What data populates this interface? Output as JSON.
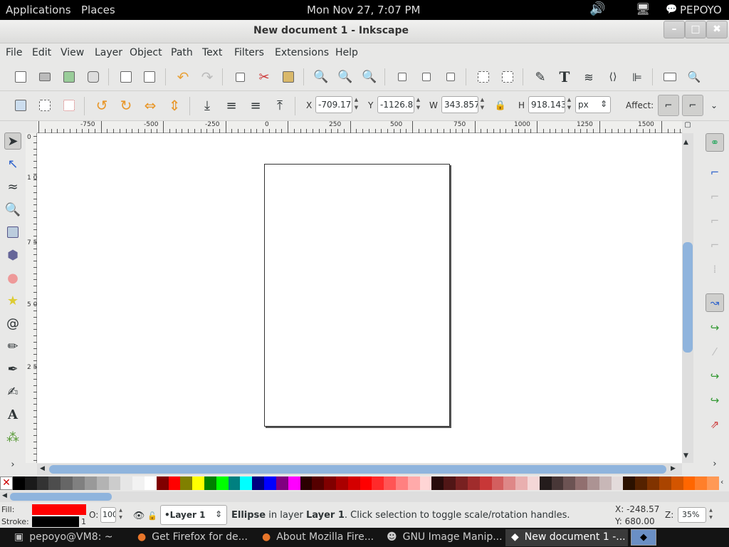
{
  "topbar": {
    "applications": "Applications",
    "places": "Places",
    "clock": "Mon Nov 27,  7:07 PM",
    "user": "PEPOYO"
  },
  "window": {
    "title": "New document 1 - Inkscape",
    "minimize": "–",
    "maximize": "□",
    "close": "✖"
  },
  "menu": [
    "File",
    "Edit",
    "View",
    "Layer",
    "Object",
    "Path",
    "Text",
    "Filters",
    "Extensions",
    "Help"
  ],
  "toolbar": {
    "x_label": "X",
    "x_value": "-709.17",
    "y_label": "Y",
    "y_value": "-1126.8",
    "w_label": "W",
    "w_value": "343.857",
    "h_label": "H",
    "h_value": "918.143",
    "unit": "px",
    "affect_label": "Affect:"
  },
  "ruler": {
    "h_ticks": [
      "-750",
      "-500",
      "-250",
      "0",
      "250",
      "500",
      "750",
      "1000",
      "1250",
      "1500"
    ],
    "v_ticks": [
      "0",
      "1 0 0 0",
      "7 5 0",
      "5 0 0",
      "2 5 0"
    ]
  },
  "palette": {
    "colors": [
      "#000000",
      "#1a1a1a",
      "#333333",
      "#4d4d4d",
      "#666666",
      "#808080",
      "#999999",
      "#b3b3b3",
      "#cccccc",
      "#e6e6e6",
      "#f2f2f2",
      "#ffffff",
      "#800000",
      "#ff0000",
      "#808000",
      "#ffff00",
      "#008000",
      "#00ff00",
      "#008080",
      "#00ffff",
      "#000080",
      "#0000ff",
      "#800080",
      "#ff00ff",
      "#2b0000",
      "#550000",
      "#800000",
      "#aa0000",
      "#d40000",
      "#ff0000",
      "#ff2a2a",
      "#ff5555",
      "#ff8080",
      "#ffaaaa",
      "#ffd5d5",
      "#280b0b",
      "#501616",
      "#782121",
      "#a02c2c",
      "#c83737",
      "#d35f5f",
      "#de8787",
      "#e9afaf",
      "#f4d7d7",
      "#241c1c",
      "#483737",
      "#6c5353",
      "#916f6f",
      "#ac9393",
      "#c8b7b7",
      "#e3dbdb",
      "#2b1100",
      "#552200",
      "#803300",
      "#aa4400",
      "#d45500",
      "#ff6600",
      "#ff7f2a",
      "#ff9955"
    ]
  },
  "status": {
    "fill_label": "Fill:",
    "stroke_label": "Stroke:",
    "stroke_width": "1",
    "opacity_label": "O:",
    "opacity_value": "100",
    "layer": "•Layer 1",
    "msg_obj": "Ellipse",
    "msg_in": " in layer ",
    "msg_layer": "Layer 1",
    "msg_rest": ". Click selection to toggle scale/rotation handles.",
    "x_coord": "X: -248.57",
    "y_coord": "Y:  680.00",
    "zoom_label": "Z:",
    "zoom_value": "35%",
    "fill_color": "#ff0000",
    "stroke_color": "#000000"
  },
  "taskbar": [
    {
      "label": "pepoyo@VM8: ~"
    },
    {
      "label": "Get Firefox for de..."
    },
    {
      "label": "About Mozilla Fire..."
    },
    {
      "label": "GNU Image Manip..."
    },
    {
      "label": "New document 1 -..."
    }
  ]
}
